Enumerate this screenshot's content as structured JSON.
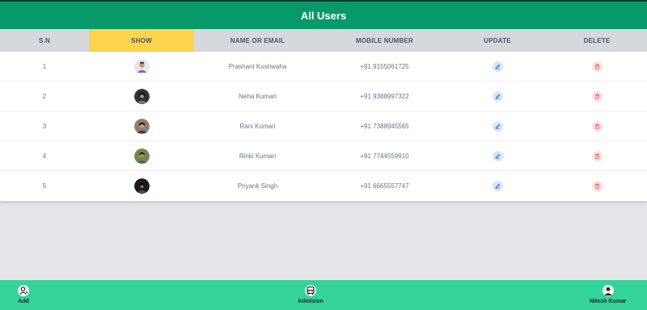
{
  "header": {
    "title": "All Users"
  },
  "table": {
    "columns": [
      "S.N",
      "SHOW",
      "NAME OR EMAIL",
      "MOBILE NUMBER",
      "UPDATE",
      "DELETE"
    ],
    "rows": [
      {
        "sn": "1",
        "name": "Prashant Kushwaha",
        "mobile": "+91 9155061725"
      },
      {
        "sn": "2",
        "name": "Neha Kumari",
        "mobile": "+91 9388997322"
      },
      {
        "sn": "3",
        "name": "Rani Kumari",
        "mobile": "+91 7388945565"
      },
      {
        "sn": "4",
        "name": "Rinki Kumari",
        "mobile": "+91 7744559910"
      },
      {
        "sn": "5",
        "name": "Priyank Singh",
        "mobile": "+91 6665557747"
      }
    ]
  },
  "footer": {
    "add_label": "Add",
    "admission_label": "Admision",
    "profile_label": "Nitesh Kumar"
  },
  "icons": [
    "user-icon",
    "avatar",
    "pencil-icon",
    "trash-icon",
    "bus-icon"
  ],
  "colors": {
    "header_bg": "#07996a",
    "footer_bg": "#34d399",
    "highlight_column": "#fcd34d",
    "edit_icon": "#3b6fd8",
    "delete_icon": "#e05252"
  }
}
